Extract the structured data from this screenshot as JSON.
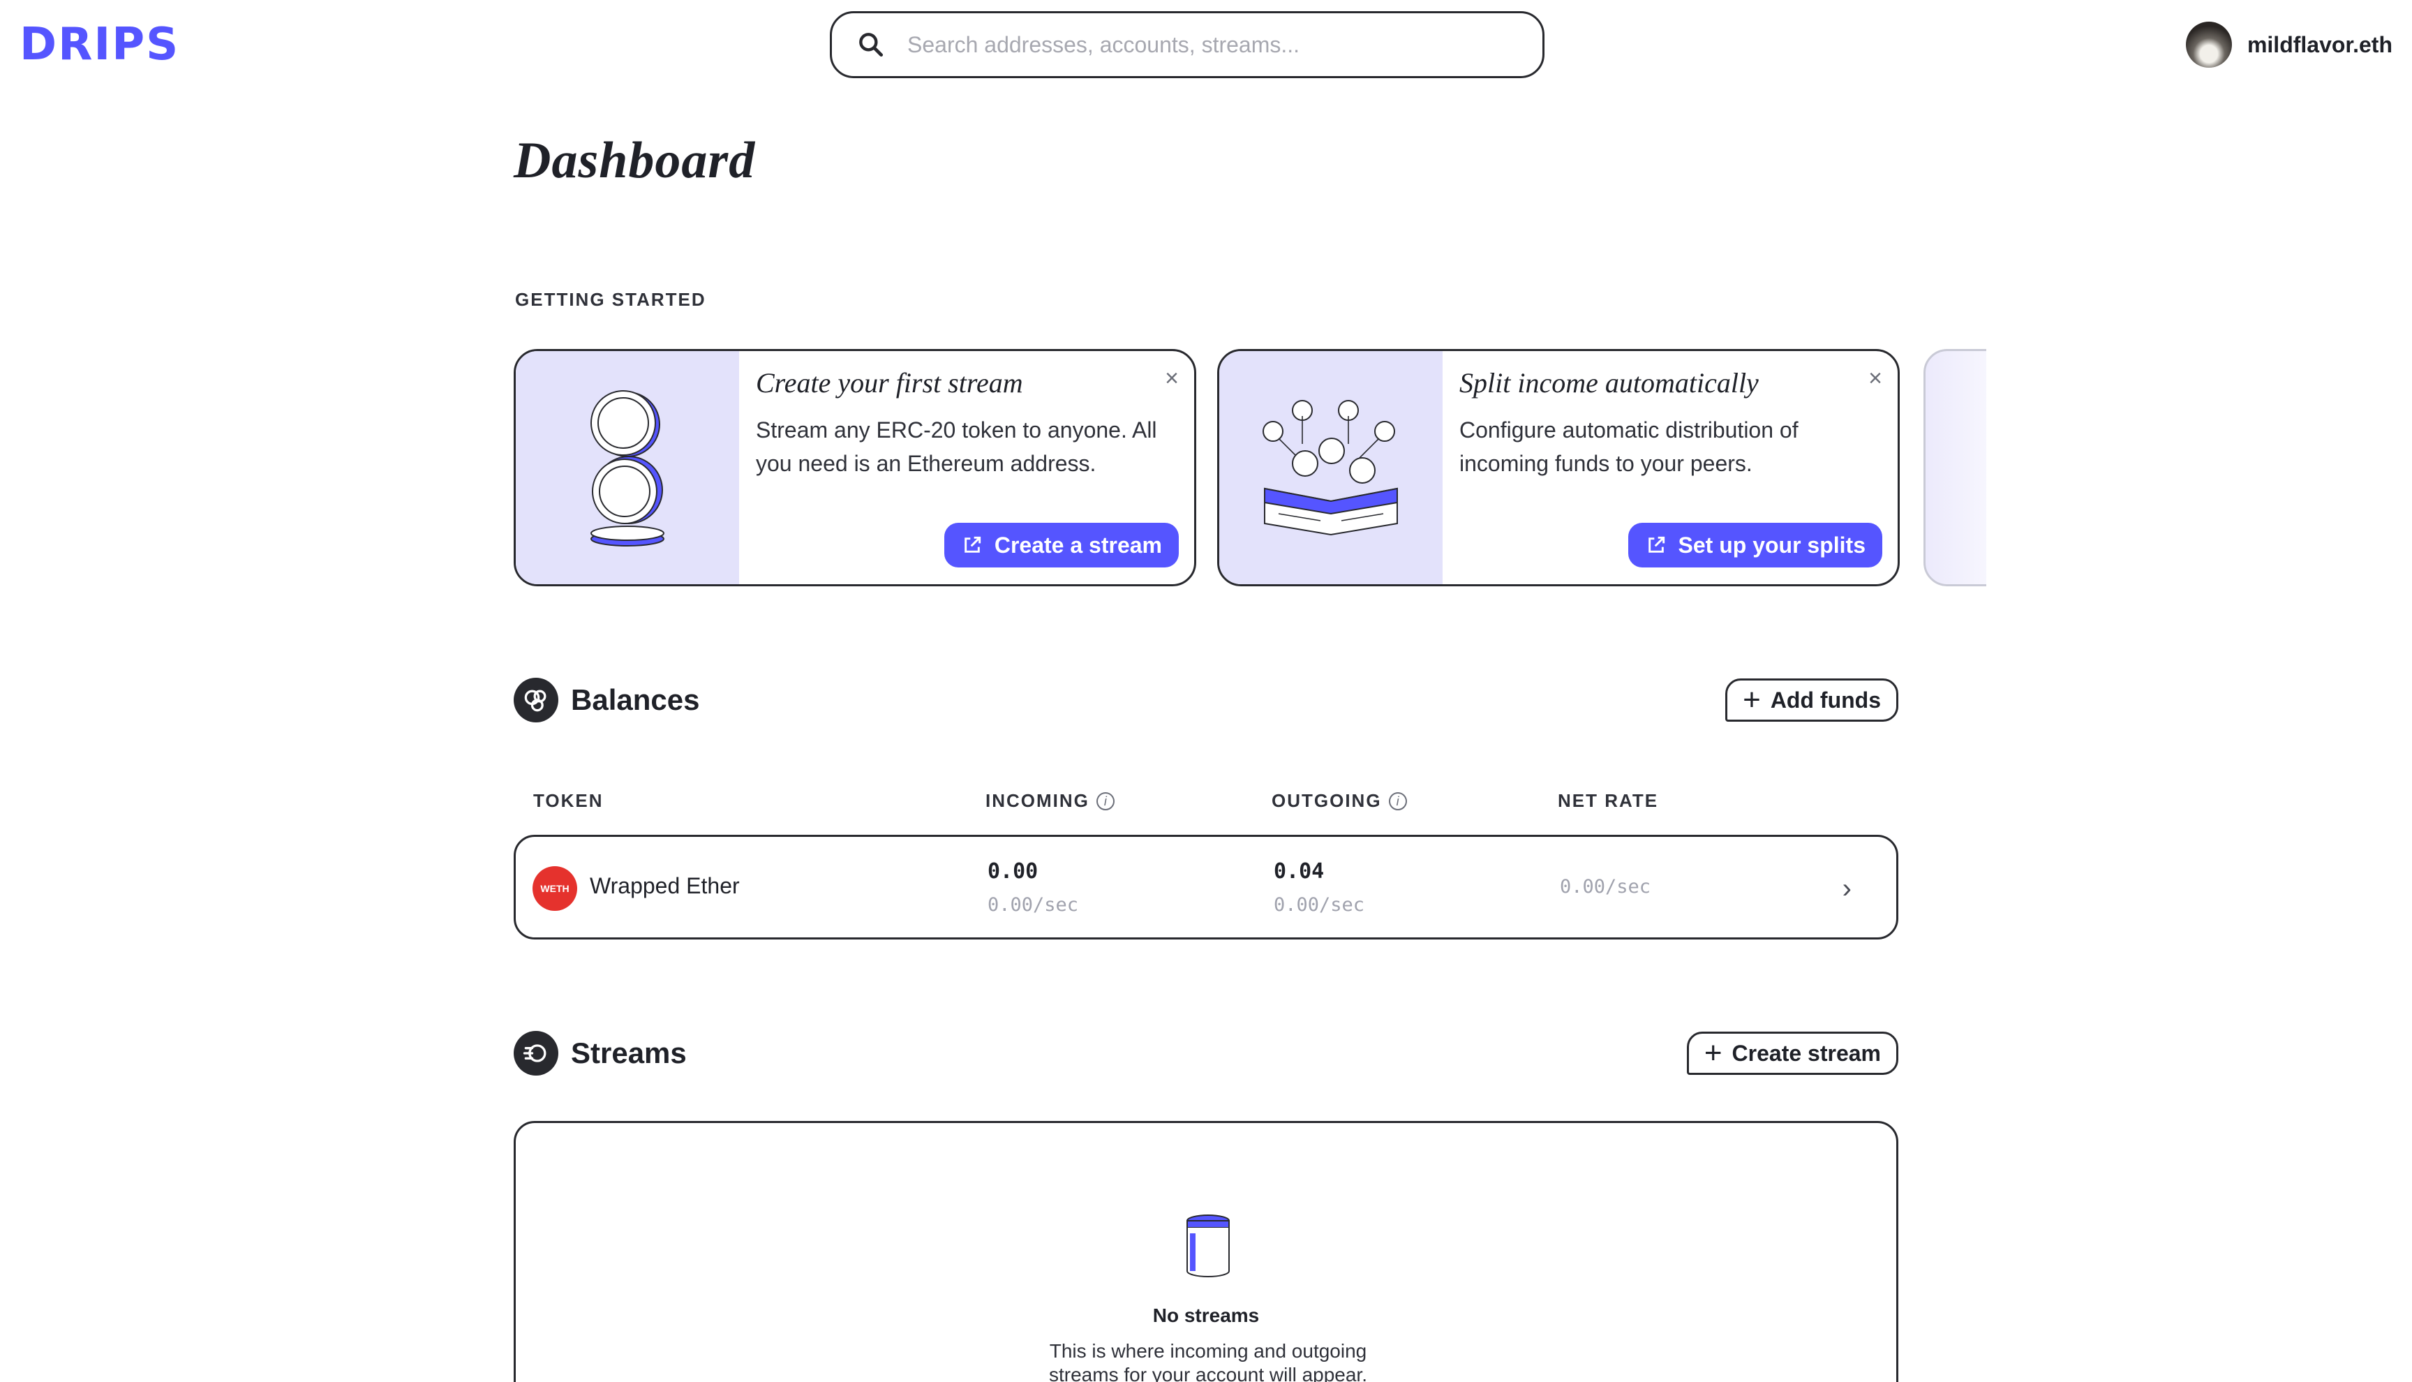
{
  "header": {
    "logo": "DRIPS",
    "search_placeholder": "Search addresses, accounts, streams...",
    "user_name": "mildflavor.eth"
  },
  "page": {
    "title": "Dashboard",
    "getting_started_label": "GETTING STARTED"
  },
  "cards": [
    {
      "title": "Create your first stream",
      "description": "Stream any ERC-20 token to anyone. All you need is an Ethereum address.",
      "cta": "Create a stream",
      "close": "×"
    },
    {
      "title": "Split income automatically",
      "description": "Configure automatic distribution of incoming funds to your peers.",
      "cta": "Set up your splits",
      "close": "×"
    }
  ],
  "balances": {
    "title": "Balances",
    "add_button": "Add funds",
    "columns": [
      "TOKEN",
      "INCOMING",
      "OUTGOING",
      "NET RATE"
    ],
    "rows": [
      {
        "badge": "WETH",
        "token": "Wrapped Ether",
        "incoming": "0.00",
        "incoming_rate": "0.00/sec",
        "outgoing": "0.04",
        "outgoing_rate": "0.00/sec",
        "net_rate": "0.00/sec"
      }
    ]
  },
  "streams": {
    "title": "Streams",
    "create_button": "Create stream",
    "empty_title": "No streams",
    "empty_description": "This is where incoming and outgoing streams for your account will appear."
  },
  "colors": {
    "accent": "#5555ff",
    "illustration_bg": "#e3e2fb",
    "weth_badge": "#e5322d",
    "border": "#28292e"
  }
}
